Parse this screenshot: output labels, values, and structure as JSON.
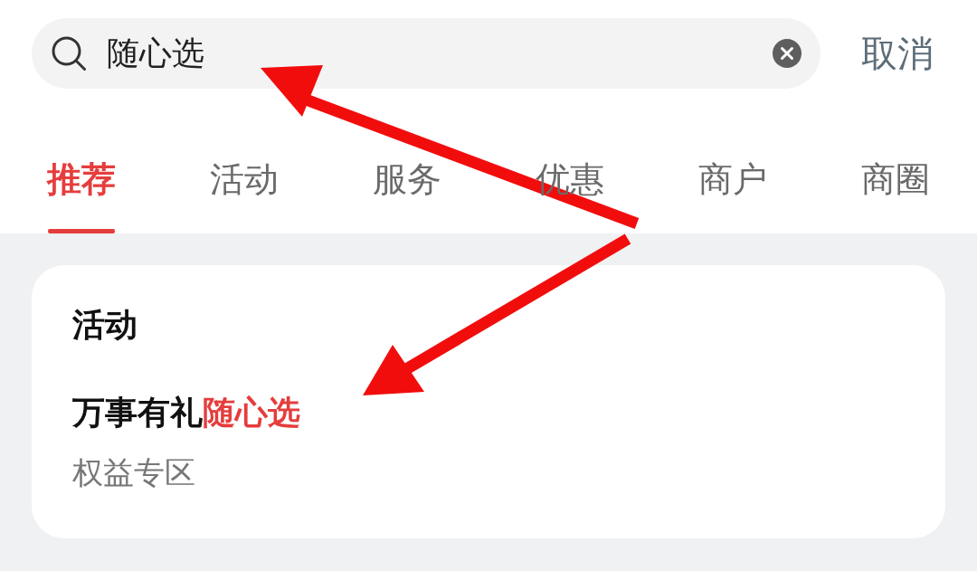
{
  "search": {
    "value": "随心选",
    "cancel": "取消"
  },
  "tabs": [
    {
      "label": "推荐",
      "selected": true
    },
    {
      "label": "活动",
      "selected": false
    },
    {
      "label": "服务",
      "selected": false
    },
    {
      "label": "优惠",
      "selected": false
    },
    {
      "label": "商户",
      "selected": false
    },
    {
      "label": "商圈",
      "selected": false
    }
  ],
  "results": [
    {
      "section": "活动",
      "items": [
        {
          "title_parts": [
            {
              "text": "万事有礼",
              "highlighted": false
            },
            {
              "text": "随心选",
              "highlighted": true
            }
          ],
          "subtitle": "权益专区"
        }
      ]
    }
  ],
  "annotation_arrows": [
    {
      "kind": "arrow"
    },
    {
      "kind": "arrow"
    }
  ]
}
